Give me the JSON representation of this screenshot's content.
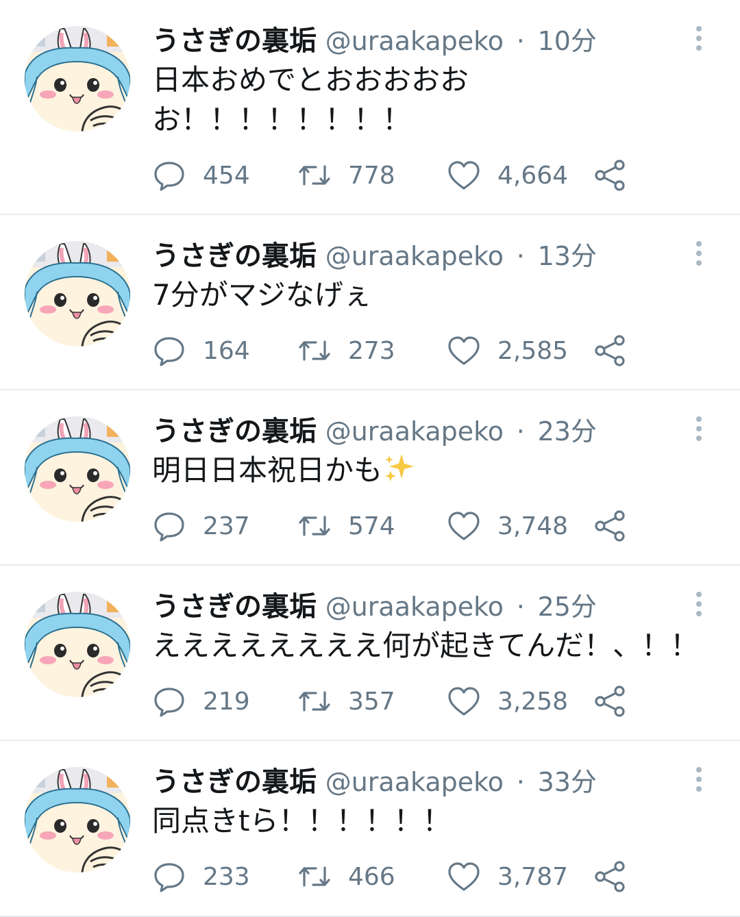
{
  "tweets": [
    {
      "name": "うさぎの裏垢",
      "handle": "@uraakapeko",
      "separator": "·",
      "time": "10分",
      "text": "日本おめでとおおおおお\nお！！！！！！！！",
      "replies": "454",
      "retweets": "778",
      "likes": "4,664"
    },
    {
      "name": "うさぎの裏垢",
      "handle": "@uraakapeko",
      "separator": "·",
      "time": "13分",
      "text": "7分がマジなげぇ",
      "replies": "164",
      "retweets": "273",
      "likes": "2,585"
    },
    {
      "name": "うさぎの裏垢",
      "handle": "@uraakapeko",
      "separator": "·",
      "time": "23分",
      "text": "明日日本祝日かも",
      "text_emoji": "sparkles-icon",
      "replies": "237",
      "retweets": "574",
      "likes": "3,748"
    },
    {
      "name": "うさぎの裏垢",
      "handle": "@uraakapeko",
      "separator": "·",
      "time": "25分",
      "text": "ええええええええ何が起きてんだ！、！！",
      "replies": "219",
      "retweets": "357",
      "likes": "3,258"
    },
    {
      "name": "うさぎの裏垢",
      "handle": "@uraakapeko",
      "separator": "·",
      "time": "33分",
      "text": "同点きtら！！！！！！",
      "replies": "233",
      "retweets": "466",
      "likes": "3,787"
    }
  ],
  "icons": {
    "reply": "reply-icon",
    "retweet": "retweet-icon",
    "like": "heart-icon",
    "share": "share-icon",
    "menu": "more-vertical-icon"
  },
  "colors": {
    "text": "#14171a",
    "secondary": "#657786",
    "divider": "#e6ecf0",
    "avatar_hair": "#8fd3ef",
    "avatar_cheek": "#f7a6b8"
  }
}
